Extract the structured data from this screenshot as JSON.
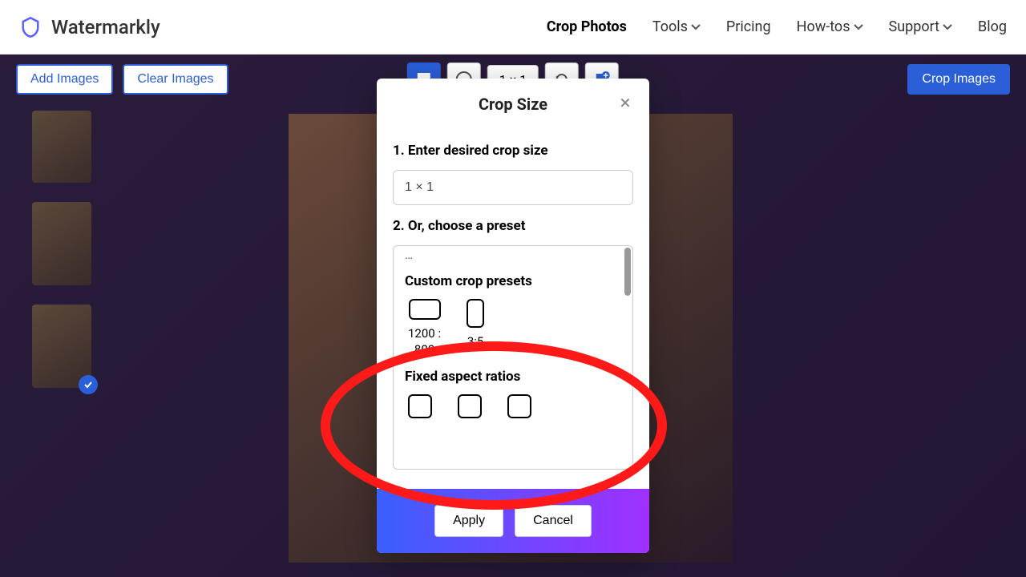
{
  "brand": "Watermarkly",
  "nav": {
    "crop": "Crop Photos",
    "tools": "Tools",
    "pricing": "Pricing",
    "howtos": "How-tos",
    "support": "Support",
    "blog": "Blog"
  },
  "toolbar": {
    "add": "Add Images",
    "clear": "Clear Images",
    "ratio": "1 × 1",
    "crop": "Crop Images"
  },
  "modal": {
    "title": "Crop Size",
    "step1": "1. Enter desired crop size",
    "input_value": "1 × 1",
    "step2": "2. Or, choose a preset",
    "section_custom": "Custom crop presets",
    "preset1": "1200 :\n800",
    "preset2": "3:5",
    "section_fixed": "Fixed aspect ratios",
    "apply": "Apply",
    "cancel": "Cancel"
  }
}
